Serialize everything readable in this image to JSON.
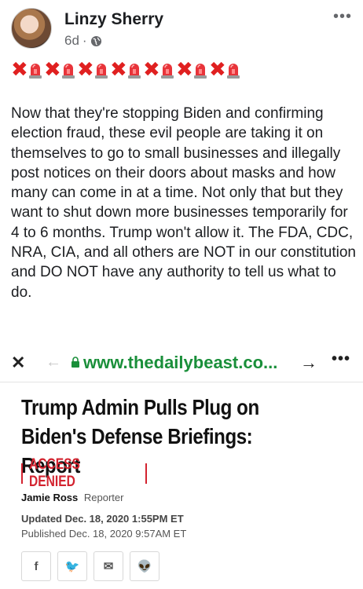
{
  "post": {
    "author_name": "Linzy Sherry",
    "time_ago": "6d",
    "separator": "·",
    "more_icon": "more-options-icon",
    "emoji_row": [
      "cross-mark",
      "siren",
      "cross-mark",
      "siren",
      "cross-mark",
      "siren",
      "cross-mark",
      "siren",
      "cross-mark",
      "siren",
      "cross-mark",
      "siren",
      "cross-mark",
      "siren"
    ],
    "body": "Now that they're stopping Biden and confirming election fraud, these evil people are taking it on themselves to go to small businesses and illegally post notices on their doors about masks and how many can come in at a time. Not only that but they want to shut down more businesses temporarily for 4 to 6 months. Trump won't allow it. The FDA, CDC, NRA, CIA, and all others are NOT in our constitution and DO NOT have any authority to tell us what to do."
  },
  "browser": {
    "close_glyph": "✕",
    "back_glyph": "←",
    "url": "www.thedailybeast.co...",
    "forward_glyph": "→",
    "more_glyph": "•••"
  },
  "article": {
    "title": "Trump Admin Pulls Plug on Biden's Defense Briefings: Report",
    "tag": "ACCESS DENIED",
    "author": "Jamie Ross",
    "author_role": "Reporter",
    "updated": "Updated Dec. 18, 2020 1:55PM ET",
    "published": "Published Dec. 18, 2020 9:57AM ET",
    "share_buttons": [
      {
        "icon": "facebook-icon",
        "glyph": "f"
      },
      {
        "icon": "twitter-icon",
        "glyph": "🐦"
      },
      {
        "icon": "email-icon",
        "glyph": "✉"
      },
      {
        "icon": "reddit-icon",
        "glyph": "👽"
      }
    ]
  },
  "colors": {
    "url_green": "#1a8f3a",
    "tag_red": "#d3232f",
    "cross_red": "#e02020"
  }
}
